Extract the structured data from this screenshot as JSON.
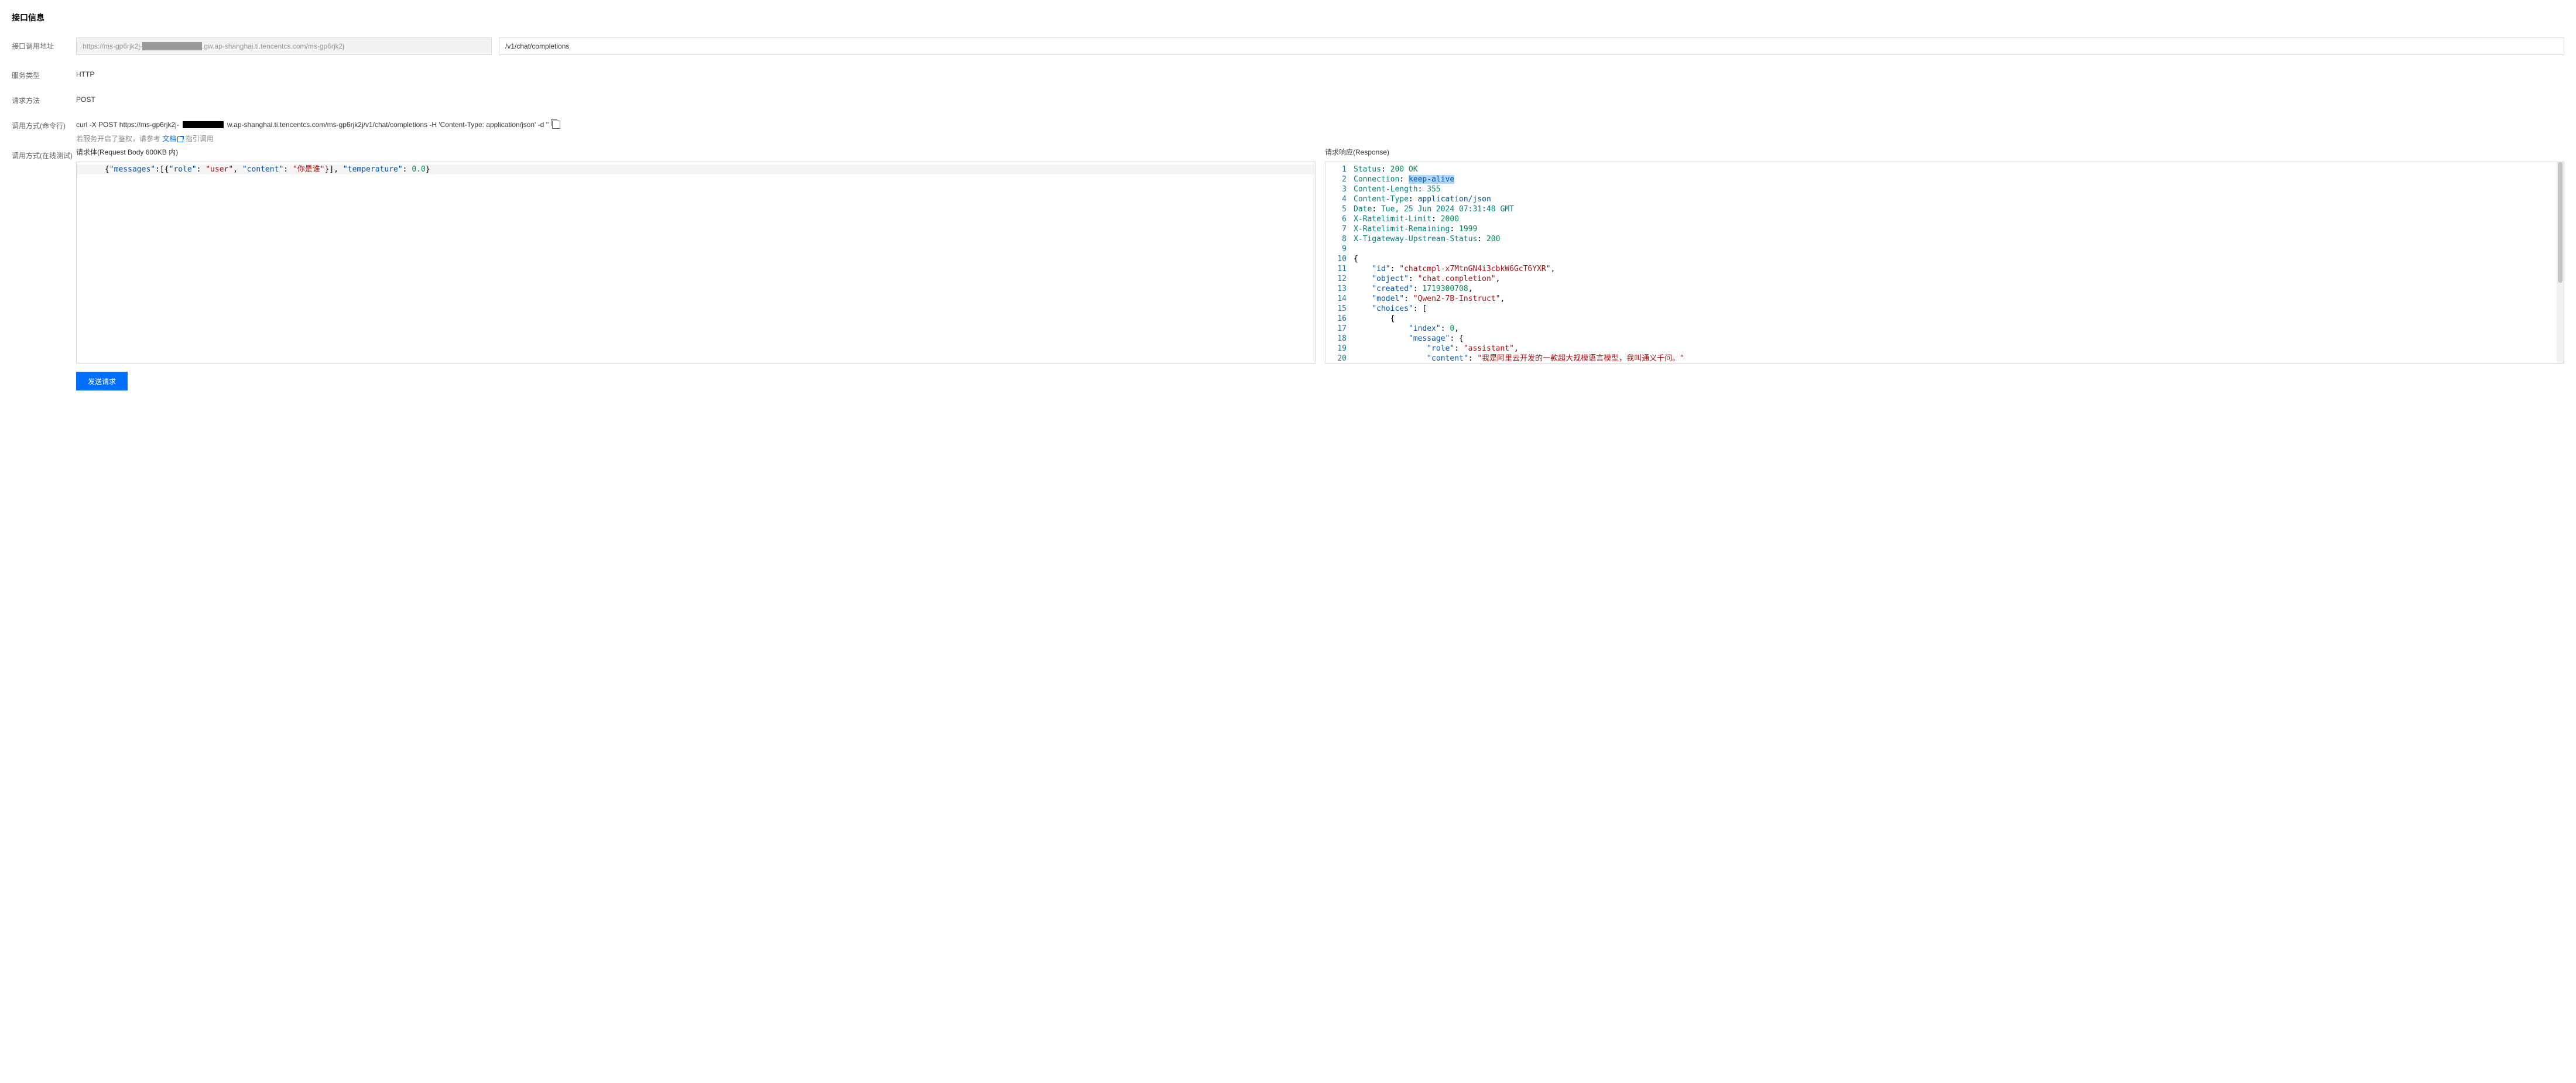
{
  "title": "接口信息",
  "rows": {
    "address_label": "接口调用地址",
    "address_base": "https://ms-gp6rjk2j-████████████.gw.ap-shanghai.ti.tencentcs.com/ms-gp6rjk2j",
    "address_path": "/v1/chat/completions",
    "service_type_label": "服务类型",
    "service_type_value": "HTTP",
    "method_label": "请求方法",
    "method_value": "POST",
    "cmd_label": "调用方式(命令行)",
    "cmd_prefix": "curl -X POST https://ms-gp6rjk2j-",
    "cmd_suffix": "w.ap-shanghai.ti.tencentcs.com/ms-gp6rjk2j/v1/chat/completions -H 'Content-Type: application/json' -d ''",
    "cmd_hint_pre": "若服务开启了鉴权，请参考",
    "cmd_hint_link": "文档",
    "cmd_hint_post": "指引调用",
    "online_label": "调用方式(在线测试)"
  },
  "request_panel": {
    "title": "请求体(Request Body 600KB 内)",
    "body_tokens": [
      {
        "t": "{",
        "c": "tk-punct"
      },
      {
        "t": "\"messages\"",
        "c": "tk-key"
      },
      {
        "t": ":[{",
        "c": "tk-punct"
      },
      {
        "t": "\"role\"",
        "c": "tk-key"
      },
      {
        "t": ": ",
        "c": "tk-punct"
      },
      {
        "t": "\"user\"",
        "c": "tk-str"
      },
      {
        "t": ", ",
        "c": "tk-punct"
      },
      {
        "t": "\"content\"",
        "c": "tk-key"
      },
      {
        "t": ": ",
        "c": "tk-punct"
      },
      {
        "t": "\"你是谁\"",
        "c": "tk-str"
      },
      {
        "t": "}], ",
        "c": "tk-punct"
      },
      {
        "t": "\"temperature\"",
        "c": "tk-key"
      },
      {
        "t": ": ",
        "c": "tk-punct"
      },
      {
        "t": "0.0",
        "c": "tk-num"
      },
      {
        "t": "}",
        "c": "tk-punct"
      }
    ]
  },
  "response_panel": {
    "title": "请求响应(Response)",
    "lines": [
      [
        {
          "t": "Status",
          "c": "tk-hdr"
        },
        {
          "t": ": ",
          "c": "tk-punct"
        },
        {
          "t": "200 OK",
          "c": "tk-num"
        }
      ],
      [
        {
          "t": "Connection",
          "c": "tk-hdr"
        },
        {
          "t": ": ",
          "c": "tk-punct"
        },
        {
          "t": "keep-alive",
          "c": "tk-sel tk-hdrv"
        }
      ],
      [
        {
          "t": "Content-Length",
          "c": "tk-hdr"
        },
        {
          "t": ": ",
          "c": "tk-punct"
        },
        {
          "t": "355",
          "c": "tk-num"
        }
      ],
      [
        {
          "t": "Content-Type",
          "c": "tk-hdr"
        },
        {
          "t": ": ",
          "c": "tk-punct"
        },
        {
          "t": "application/json",
          "c": "tk-hdrv"
        }
      ],
      [
        {
          "t": "Date",
          "c": "tk-hdr"
        },
        {
          "t": ": ",
          "c": "tk-punct"
        },
        {
          "t": "Tue, 25 Jun 2024 07:31:48 GMT",
          "c": "tk-hdr"
        }
      ],
      [
        {
          "t": "X-Ratelimit-Limit",
          "c": "tk-hdr"
        },
        {
          "t": ": ",
          "c": "tk-punct"
        },
        {
          "t": "2000",
          "c": "tk-num"
        }
      ],
      [
        {
          "t": "X-Ratelimit-Remaining",
          "c": "tk-hdr"
        },
        {
          "t": ": ",
          "c": "tk-punct"
        },
        {
          "t": "1999",
          "c": "tk-num"
        }
      ],
      [
        {
          "t": "X-Tigateway-Upstream-Status",
          "c": "tk-hdr"
        },
        {
          "t": ": ",
          "c": "tk-punct"
        },
        {
          "t": "200",
          "c": "tk-num"
        }
      ],
      [],
      [
        {
          "t": "{",
          "c": "tk-punct"
        }
      ],
      [
        {
          "t": "    ",
          "c": ""
        },
        {
          "t": "\"id\"",
          "c": "tk-key"
        },
        {
          "t": ": ",
          "c": "tk-punct"
        },
        {
          "t": "\"chatcmpl-x7MtnGN4i3cbkW6GcT6YXR\"",
          "c": "tk-str"
        },
        {
          "t": ",",
          "c": "tk-punct"
        }
      ],
      [
        {
          "t": "    ",
          "c": ""
        },
        {
          "t": "\"object\"",
          "c": "tk-key"
        },
        {
          "t": ": ",
          "c": "tk-punct"
        },
        {
          "t": "\"chat.completion\"",
          "c": "tk-str"
        },
        {
          "t": ",",
          "c": "tk-punct"
        }
      ],
      [
        {
          "t": "    ",
          "c": ""
        },
        {
          "t": "\"created\"",
          "c": "tk-key"
        },
        {
          "t": ": ",
          "c": "tk-punct"
        },
        {
          "t": "1719300708",
          "c": "tk-num"
        },
        {
          "t": ",",
          "c": "tk-punct"
        }
      ],
      [
        {
          "t": "    ",
          "c": ""
        },
        {
          "t": "\"model\"",
          "c": "tk-key"
        },
        {
          "t": ": ",
          "c": "tk-punct"
        },
        {
          "t": "\"Qwen2-7B-Instruct\"",
          "c": "tk-str"
        },
        {
          "t": ",",
          "c": "tk-punct"
        }
      ],
      [
        {
          "t": "    ",
          "c": ""
        },
        {
          "t": "\"choices\"",
          "c": "tk-key"
        },
        {
          "t": ": [",
          "c": "tk-punct"
        }
      ],
      [
        {
          "t": "        {",
          "c": "tk-punct"
        }
      ],
      [
        {
          "t": "            ",
          "c": ""
        },
        {
          "t": "\"index\"",
          "c": "tk-key"
        },
        {
          "t": ": ",
          "c": "tk-punct"
        },
        {
          "t": "0",
          "c": "tk-num"
        },
        {
          "t": ",",
          "c": "tk-punct"
        }
      ],
      [
        {
          "t": "            ",
          "c": ""
        },
        {
          "t": "\"message\"",
          "c": "tk-key"
        },
        {
          "t": ": {",
          "c": "tk-punct"
        }
      ],
      [
        {
          "t": "                ",
          "c": ""
        },
        {
          "t": "\"role\"",
          "c": "tk-key"
        },
        {
          "t": ": ",
          "c": "tk-punct"
        },
        {
          "t": "\"assistant\"",
          "c": "tk-str"
        },
        {
          "t": ",",
          "c": "tk-punct"
        }
      ],
      [
        {
          "t": "                ",
          "c": ""
        },
        {
          "t": "\"content\"",
          "c": "tk-key"
        },
        {
          "t": ": ",
          "c": "tk-punct"
        },
        {
          "t": "\"我是阿里云开发的一款超大规模语言模型，我叫通义千问。\"",
          "c": "tk-str"
        }
      ],
      [
        {
          "t": "            },",
          "c": "tk-punct"
        }
      ]
    ]
  },
  "send_button": "发送请求"
}
